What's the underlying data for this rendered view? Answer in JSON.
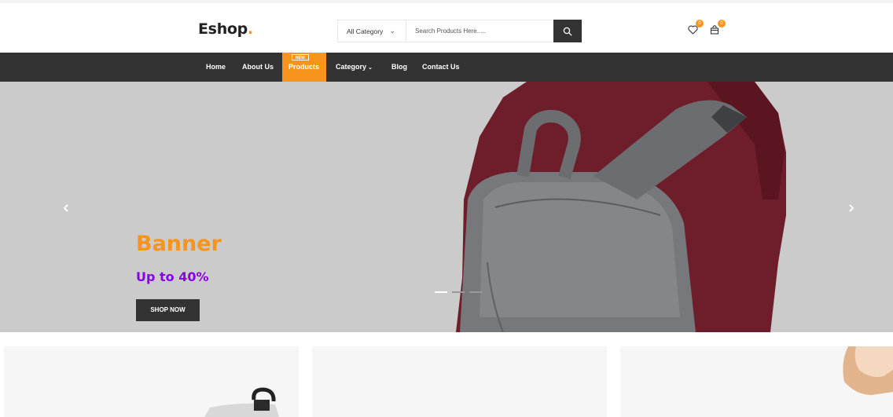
{
  "header": {
    "logo": "Eshop",
    "logo_dot": ".",
    "search": {
      "category": "All Category",
      "placeholder": "Search Products Here....."
    },
    "wishlist_count": "0",
    "cart_count": "0",
    "icons": [
      "heart-icon",
      "shopping-bag-icon",
      "search-icon"
    ]
  },
  "nav": {
    "items": [
      {
        "label": "Home"
      },
      {
        "label": "About Us"
      },
      {
        "label": "Products",
        "tag": "NEW",
        "active": true
      },
      {
        "label": "Category",
        "has_dropdown": true
      },
      {
        "label": "Blog"
      },
      {
        "label": "Contact Us"
      }
    ]
  },
  "hero": {
    "title": "Banner",
    "subtitle": "Up to 40%",
    "cta": "SHOP NOW",
    "slides": 3,
    "active_slide": 1
  },
  "colors": {
    "accent": "#f7941d",
    "dark": "#333333",
    "subtitle": "#8a00e6",
    "hero_bg": "#cbcbcb"
  }
}
